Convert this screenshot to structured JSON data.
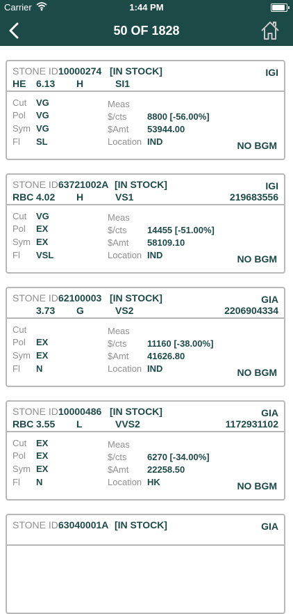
{
  "status_bar": {
    "carrier": "Carrier",
    "time": "1:44 PM"
  },
  "nav": {
    "title": "50 OF 1828"
  },
  "labels": {
    "stone_id": "STONE ID:",
    "cut": "Cut",
    "pol": "Pol",
    "sym": "Sym",
    "fl": "Fl",
    "meas": "Meas",
    "price_per_ct": "$/cts",
    "amount": "$Amt",
    "location": "Location"
  },
  "cards": [
    {
      "id": "10000274",
      "status": "[IN STOCK]",
      "lab": "IGI",
      "cert": "",
      "shape": "HE",
      "carat": "6.13",
      "color": "H",
      "clarity": "SI1",
      "cut": "VG",
      "pol": "VG",
      "sym": "VG",
      "fl": "SL",
      "meas": "",
      "price": "8800 [-56.00%]",
      "amount": "53944.00",
      "location": "IND",
      "bgm": "NO BGM"
    },
    {
      "id": "63721002A",
      "status": "[IN STOCK]",
      "lab": "IGI",
      "cert": "219683556",
      "shape": "RBC",
      "carat": "4.02",
      "color": "H",
      "clarity": "VS1",
      "cut": "VG",
      "pol": "EX",
      "sym": "EX",
      "fl": "VSL",
      "meas": "",
      "price": "14455 [-51.00%]",
      "amount": "58109.10",
      "location": "IND",
      "bgm": "NO BGM"
    },
    {
      "id": "62100003",
      "status": "[IN STOCK]",
      "lab": "GIA",
      "cert": "2206904334",
      "shape": "",
      "carat": "3.73",
      "color": "G",
      "clarity": "VS2",
      "cut": "",
      "pol": "EX",
      "sym": "EX",
      "fl": "N",
      "meas": "",
      "price": "11160 [-38.00%]",
      "amount": "41626.80",
      "location": "IND",
      "bgm": "NO BGM"
    },
    {
      "id": "10000486",
      "status": "[IN STOCK]",
      "lab": "GIA",
      "cert": "1172931102",
      "shape": "RBC",
      "carat": "3.55",
      "color": "L",
      "clarity": "VVS2",
      "cut": "EX",
      "pol": "EX",
      "sym": "EX",
      "fl": "N",
      "meas": "",
      "price": "6270 [-34.00%]",
      "amount": "22258.50",
      "location": "HK",
      "bgm": "NO BGM"
    },
    {
      "id": "63040001A",
      "status": "[IN STOCK]",
      "lab": "GIA",
      "cert": "",
      "shape": "",
      "carat": "",
      "color": "",
      "clarity": "",
      "cut": "",
      "pol": "",
      "sym": "",
      "fl": "",
      "meas": "",
      "price": "",
      "amount": "",
      "location": "",
      "bgm": ""
    }
  ]
}
